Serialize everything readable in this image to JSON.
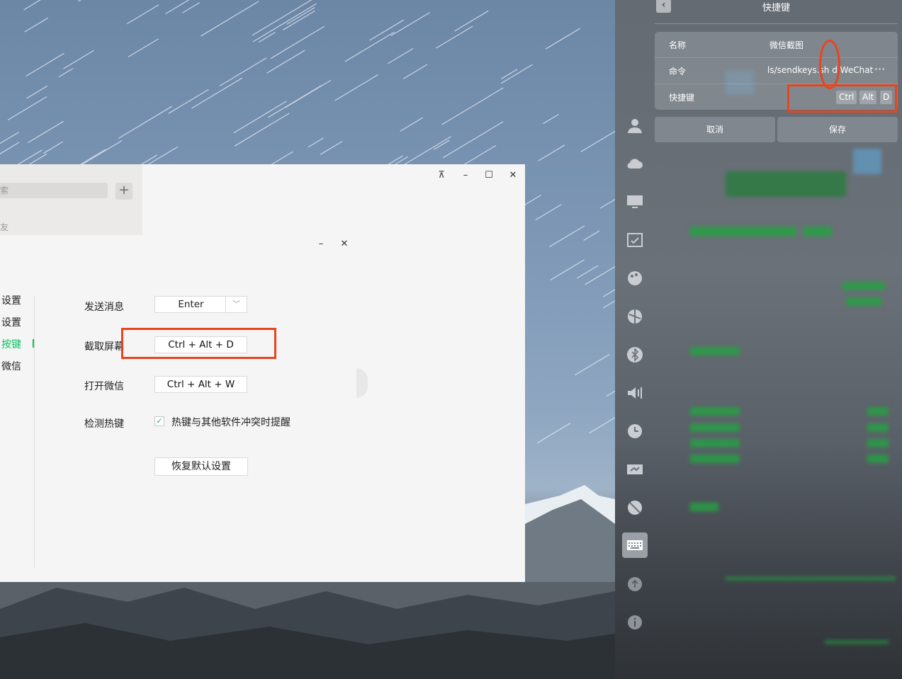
{
  "wechat": {
    "search_placeholder": "索",
    "add_symbol": "+",
    "friends_label": "友",
    "title_buttons": {
      "pin": "⊼",
      "minimize": "–",
      "maximize": "☐",
      "close": "✕"
    }
  },
  "settings": {
    "dialog_buttons": {
      "minimize": "–",
      "close": "✕"
    },
    "nav": [
      "设置",
      "设置",
      "按键",
      "微信"
    ],
    "active_nav_index": 2,
    "rows": {
      "send_label": "发送消息",
      "send_value": "Enter",
      "capture_label": "截取屏幕",
      "capture_value": "Ctrl + Alt + D",
      "open_label": "打开微信",
      "open_value": "Ctrl + Alt + W",
      "detect_label": "检测热键",
      "detect_checkbox_label": "热键与其他软件冲突时提醒",
      "detect_checked": true
    },
    "restore_label": "恢复默认设置"
  },
  "control_center": {
    "title": "快捷键",
    "name_label": "名称",
    "name_value": "微信截图",
    "command_label": "命令",
    "command_value": "ls/sendkeys.sh d WeChat",
    "more_symbol": "···",
    "shortcut_label": "快捷键",
    "keys": [
      "Ctrl",
      "Alt",
      "D"
    ],
    "cancel_label": "取消",
    "save_label": "保存",
    "accent": "#e9441e"
  }
}
